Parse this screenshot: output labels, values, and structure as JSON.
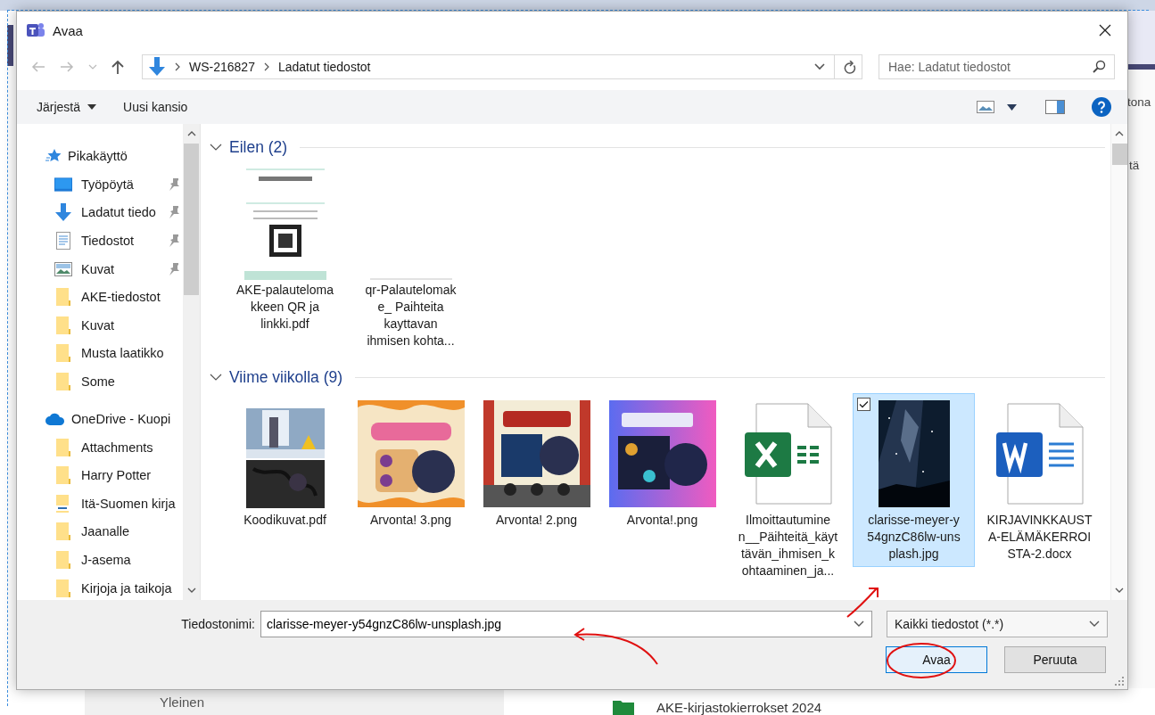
{
  "background": {
    "header_text": "tona",
    "side_text": "tä",
    "channel": "Yleinen",
    "folder": "AKE-kirjastokierrokset 2024"
  },
  "dialog": {
    "title": "Avaa",
    "address": {
      "path": [
        "WS-216827",
        "Ladatut tiedostot"
      ]
    },
    "search": {
      "placeholder": "Hae: Ladatut tiedostot"
    },
    "toolbar": {
      "organize": "Järjestä",
      "new_folder": "Uusi kansio"
    },
    "sidebar": [
      {
        "kind": "quick",
        "label": "Pikakäyttö",
        "children": [
          {
            "kind": "desktop",
            "label": "Työpöytä",
            "pinned": true
          },
          {
            "kind": "download",
            "label": "Ladatut tiedo",
            "pinned": true
          },
          {
            "kind": "documents",
            "label": "Tiedostot",
            "pinned": true
          },
          {
            "kind": "pictures",
            "label": "Kuvat",
            "pinned": true
          },
          {
            "kind": "folder",
            "label": "AKE-tiedostot",
            "pinned": false
          },
          {
            "kind": "folder",
            "label": "Kuvat",
            "pinned": false
          },
          {
            "kind": "folder",
            "label": "Musta laatikko",
            "pinned": false
          },
          {
            "kind": "folder",
            "label": "Some",
            "pinned": false
          }
        ]
      },
      {
        "kind": "cloud",
        "label": "OneDrive - Kuopi",
        "children": [
          {
            "kind": "folder",
            "label": "Attachments",
            "pinned": false
          },
          {
            "kind": "folder",
            "label": "Harry Potter",
            "pinned": false
          },
          {
            "kind": "link",
            "label": "Itä-Suomen kirja",
            "pinned": false
          },
          {
            "kind": "folder",
            "label": "Jaanalle",
            "pinned": false
          },
          {
            "kind": "folder",
            "label": "J-asema",
            "pinned": false
          },
          {
            "kind": "folder",
            "label": "Kirjoja ja taikoja",
            "pinned": false
          }
        ]
      }
    ],
    "groups": [
      {
        "label": "Eilen (2)",
        "expanded": true,
        "files": [
          {
            "kind": "doc-preview",
            "label_lines": [
              "AKE-palauteloma",
              "kkeen QR ja",
              "linkki.pdf"
            ],
            "selected": false
          },
          {
            "kind": "blank",
            "label_lines": [
              "qr-Palautelomak",
              "e_ Paihteita",
              "kayttavan",
              "ihmisen kohta..."
            ],
            "selected": false
          }
        ]
      },
      {
        "label": "Viime viikolla (9)",
        "expanded": true,
        "files": [
          {
            "kind": "lab-photo",
            "label_lines": [
              "Koodikuvat.pdf"
            ],
            "selected": false
          },
          {
            "kind": "poster-warm",
            "label_lines": [
              "Arvonta! 3.png"
            ],
            "selected": false
          },
          {
            "kind": "poster-stage",
            "label_lines": [
              "Arvonta! 2.png"
            ],
            "selected": false
          },
          {
            "kind": "poster-gradient",
            "label_lines": [
              "Arvonta!.png"
            ],
            "selected": false
          },
          {
            "kind": "excel",
            "label_lines": [
              "Ilmoittautumine",
              "n__Päihteitä_käyt",
              "tävän_ihmisen_k",
              "ohtaaminen_ja..."
            ],
            "selected": false
          },
          {
            "kind": "night-sky",
            "label_lines": [
              "clarisse-meyer-y",
              "54gnzC86lw-uns",
              "plash.jpg"
            ],
            "selected": true
          },
          {
            "kind": "word",
            "label_lines": [
              "KIRJAVINKKAUST",
              "A-ELÄMÄKERROI",
              "STA-2.docx"
            ],
            "selected": false
          }
        ]
      }
    ],
    "file_name": {
      "label": "Tiedostonimi:",
      "value": "clarisse-meyer-y54gnzC86lw-unsplash.jpg"
    },
    "filter": {
      "value": "Kaikki tiedostot (*.*)"
    },
    "buttons": [
      {
        "label": "Avaa",
        "default": true
      },
      {
        "label": "Peruuta",
        "default": false
      }
    ]
  }
}
